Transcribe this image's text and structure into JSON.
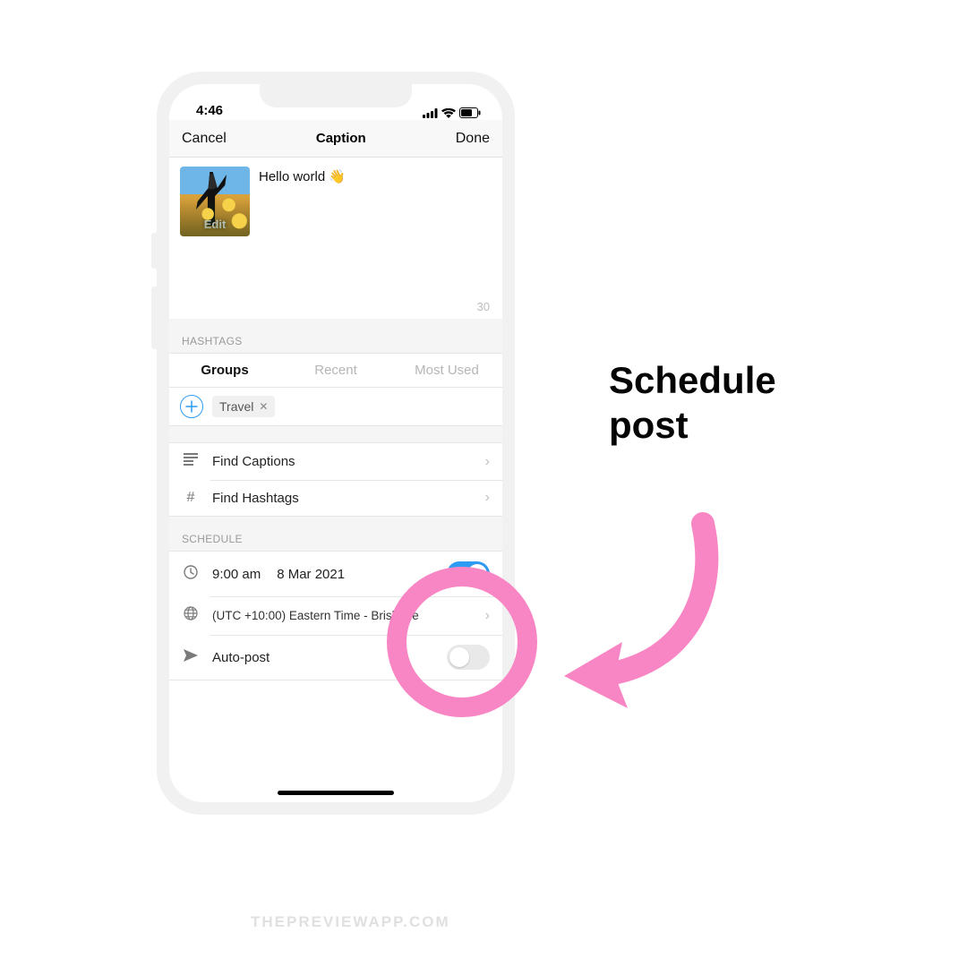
{
  "status": {
    "time": "4:46"
  },
  "nav": {
    "cancel": "Cancel",
    "title": "Caption",
    "done": "Done"
  },
  "caption": {
    "text": "Hello world 👋",
    "thumb_label": "Edit",
    "counter": "30"
  },
  "hashtags": {
    "section_label": "HASHTAGS",
    "tabs": {
      "groups": "Groups",
      "recent": "Recent",
      "most_used": "Most Used"
    },
    "chip": "Travel"
  },
  "tools": {
    "find_captions": "Find Captions",
    "find_hashtags": "Find Hashtags"
  },
  "schedule": {
    "section_label": "SCHEDULE",
    "time": "9:00 am",
    "date": "8 Mar 2021",
    "timezone": "(UTC +10:00) Eastern Time - Brisbane",
    "autopost": "Auto-post"
  },
  "annotation": {
    "line1": "Schedule",
    "line2": "post"
  },
  "watermark": "THEPREVIEWAPP.COM"
}
